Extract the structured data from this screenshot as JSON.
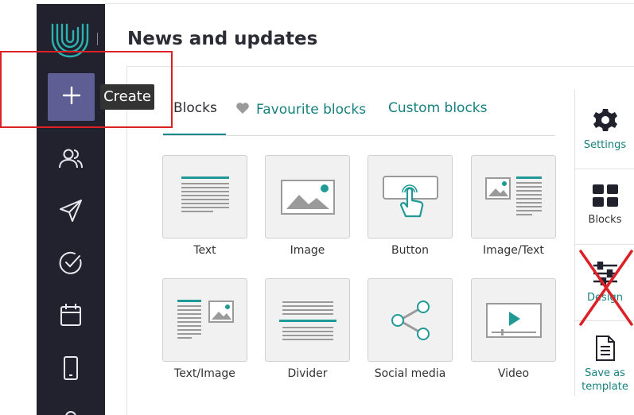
{
  "page": {
    "title": "News and updates"
  },
  "sidebar": {
    "logo": "logo-icon",
    "create_icon": "plus-icon",
    "items": [
      {
        "icon": "contacts-icon"
      },
      {
        "icon": "send-icon"
      },
      {
        "icon": "check-circle-icon"
      },
      {
        "icon": "calendar-icon"
      },
      {
        "icon": "mobile-icon"
      }
    ]
  },
  "tooltip": {
    "label": "Create"
  },
  "tabs": [
    {
      "label": "Blocks",
      "active": true
    },
    {
      "label": "Favourite blocks",
      "icon": "heart-icon"
    },
    {
      "label": "Custom blocks"
    }
  ],
  "blocks": [
    {
      "label": "Text",
      "icon": "text-block-icon"
    },
    {
      "label": "Image",
      "icon": "image-block-icon"
    },
    {
      "label": "Button",
      "icon": "button-block-icon"
    },
    {
      "label": "Image/Text",
      "icon": "image-text-block-icon"
    },
    {
      "label": "Text/Image",
      "icon": "text-image-block-icon"
    },
    {
      "label": "Divider",
      "icon": "divider-block-icon"
    },
    {
      "label": "Social media",
      "icon": "share-icon"
    },
    {
      "label": "Video",
      "icon": "video-block-icon"
    }
  ],
  "right_panel": {
    "settings_label": "Settings",
    "blocks_label": "Blocks",
    "design_label": "Design",
    "save_template_label": "Save as template"
  },
  "colors": {
    "sidebar_bg": "#22212e",
    "create_bg": "#5e5e95",
    "accent_teal": "#16807e",
    "highlight_red": "#dd1f26"
  }
}
